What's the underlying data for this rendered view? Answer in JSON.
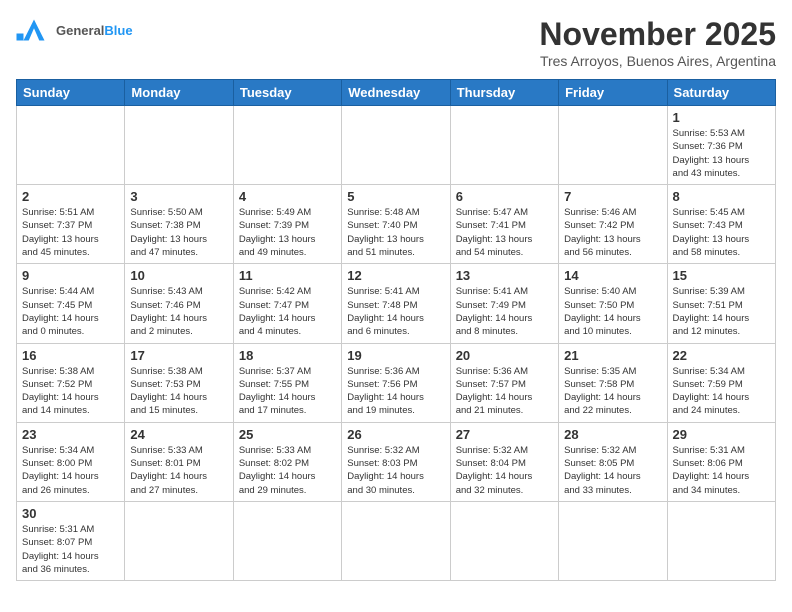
{
  "header": {
    "logo_general": "General",
    "logo_blue": "Blue",
    "month_title": "November 2025",
    "subtitle": "Tres Arroyos, Buenos Aires, Argentina"
  },
  "weekdays": [
    "Sunday",
    "Monday",
    "Tuesday",
    "Wednesday",
    "Thursday",
    "Friday",
    "Saturday"
  ],
  "days": [
    {
      "day": "",
      "info": ""
    },
    {
      "day": "",
      "info": ""
    },
    {
      "day": "",
      "info": ""
    },
    {
      "day": "",
      "info": ""
    },
    {
      "day": "",
      "info": ""
    },
    {
      "day": "",
      "info": ""
    },
    {
      "day": "1",
      "info": "Sunrise: 5:53 AM\nSunset: 7:36 PM\nDaylight: 13 hours\nand 43 minutes."
    },
    {
      "day": "2",
      "info": "Sunrise: 5:51 AM\nSunset: 7:37 PM\nDaylight: 13 hours\nand 45 minutes."
    },
    {
      "day": "3",
      "info": "Sunrise: 5:50 AM\nSunset: 7:38 PM\nDaylight: 13 hours\nand 47 minutes."
    },
    {
      "day": "4",
      "info": "Sunrise: 5:49 AM\nSunset: 7:39 PM\nDaylight: 13 hours\nand 49 minutes."
    },
    {
      "day": "5",
      "info": "Sunrise: 5:48 AM\nSunset: 7:40 PM\nDaylight: 13 hours\nand 51 minutes."
    },
    {
      "day": "6",
      "info": "Sunrise: 5:47 AM\nSunset: 7:41 PM\nDaylight: 13 hours\nand 54 minutes."
    },
    {
      "day": "7",
      "info": "Sunrise: 5:46 AM\nSunset: 7:42 PM\nDaylight: 13 hours\nand 56 minutes."
    },
    {
      "day": "8",
      "info": "Sunrise: 5:45 AM\nSunset: 7:43 PM\nDaylight: 13 hours\nand 58 minutes."
    },
    {
      "day": "9",
      "info": "Sunrise: 5:44 AM\nSunset: 7:45 PM\nDaylight: 14 hours\nand 0 minutes."
    },
    {
      "day": "10",
      "info": "Sunrise: 5:43 AM\nSunset: 7:46 PM\nDaylight: 14 hours\nand 2 minutes."
    },
    {
      "day": "11",
      "info": "Sunrise: 5:42 AM\nSunset: 7:47 PM\nDaylight: 14 hours\nand 4 minutes."
    },
    {
      "day": "12",
      "info": "Sunrise: 5:41 AM\nSunset: 7:48 PM\nDaylight: 14 hours\nand 6 minutes."
    },
    {
      "day": "13",
      "info": "Sunrise: 5:41 AM\nSunset: 7:49 PM\nDaylight: 14 hours\nand 8 minutes."
    },
    {
      "day": "14",
      "info": "Sunrise: 5:40 AM\nSunset: 7:50 PM\nDaylight: 14 hours\nand 10 minutes."
    },
    {
      "day": "15",
      "info": "Sunrise: 5:39 AM\nSunset: 7:51 PM\nDaylight: 14 hours\nand 12 minutes."
    },
    {
      "day": "16",
      "info": "Sunrise: 5:38 AM\nSunset: 7:52 PM\nDaylight: 14 hours\nand 14 minutes."
    },
    {
      "day": "17",
      "info": "Sunrise: 5:38 AM\nSunset: 7:53 PM\nDaylight: 14 hours\nand 15 minutes."
    },
    {
      "day": "18",
      "info": "Sunrise: 5:37 AM\nSunset: 7:55 PM\nDaylight: 14 hours\nand 17 minutes."
    },
    {
      "day": "19",
      "info": "Sunrise: 5:36 AM\nSunset: 7:56 PM\nDaylight: 14 hours\nand 19 minutes."
    },
    {
      "day": "20",
      "info": "Sunrise: 5:36 AM\nSunset: 7:57 PM\nDaylight: 14 hours\nand 21 minutes."
    },
    {
      "day": "21",
      "info": "Sunrise: 5:35 AM\nSunset: 7:58 PM\nDaylight: 14 hours\nand 22 minutes."
    },
    {
      "day": "22",
      "info": "Sunrise: 5:34 AM\nSunset: 7:59 PM\nDaylight: 14 hours\nand 24 minutes."
    },
    {
      "day": "23",
      "info": "Sunrise: 5:34 AM\nSunset: 8:00 PM\nDaylight: 14 hours\nand 26 minutes."
    },
    {
      "day": "24",
      "info": "Sunrise: 5:33 AM\nSunset: 8:01 PM\nDaylight: 14 hours\nand 27 minutes."
    },
    {
      "day": "25",
      "info": "Sunrise: 5:33 AM\nSunset: 8:02 PM\nDaylight: 14 hours\nand 29 minutes."
    },
    {
      "day": "26",
      "info": "Sunrise: 5:32 AM\nSunset: 8:03 PM\nDaylight: 14 hours\nand 30 minutes."
    },
    {
      "day": "27",
      "info": "Sunrise: 5:32 AM\nSunset: 8:04 PM\nDaylight: 14 hours\nand 32 minutes."
    },
    {
      "day": "28",
      "info": "Sunrise: 5:32 AM\nSunset: 8:05 PM\nDaylight: 14 hours\nand 33 minutes."
    },
    {
      "day": "29",
      "info": "Sunrise: 5:31 AM\nSunset: 8:06 PM\nDaylight: 14 hours\nand 34 minutes."
    },
    {
      "day": "30",
      "info": "Sunrise: 5:31 AM\nSunset: 8:07 PM\nDaylight: 14 hours\nand 36 minutes."
    },
    {
      "day": "",
      "info": ""
    },
    {
      "day": "",
      "info": ""
    },
    {
      "day": "",
      "info": ""
    },
    {
      "day": "",
      "info": ""
    },
    {
      "day": "",
      "info": ""
    },
    {
      "day": "",
      "info": ""
    }
  ]
}
